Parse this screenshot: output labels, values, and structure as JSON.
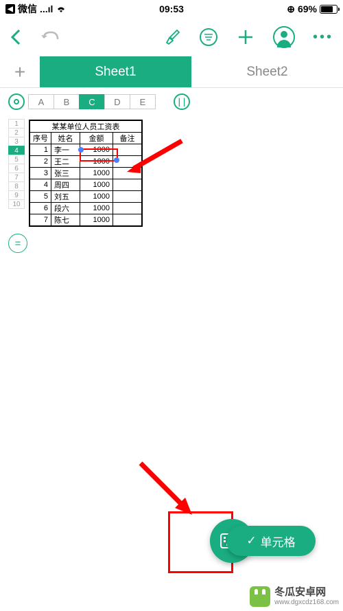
{
  "status": {
    "app": "微信",
    "signal": "...ıl",
    "wifi": "wifi-icon",
    "time": "09:53",
    "lock": "⊕",
    "battery_pct": "69%"
  },
  "toolbar": {
    "back": "back-icon",
    "undo": "undo-icon",
    "format": "brush-icon",
    "filter": "filter-icon",
    "add": "add-icon",
    "profile": "profile-icon",
    "more": "more-icon"
  },
  "sheets": {
    "add": "+",
    "tabs": [
      {
        "label": "Sheet1",
        "active": true
      },
      {
        "label": "Sheet2",
        "active": false
      }
    ]
  },
  "cols": {
    "circle_left": "○",
    "headers": [
      "A",
      "B",
      "C",
      "D",
      "E"
    ],
    "selected": "C",
    "pause": "||"
  },
  "rows": {
    "nums": [
      "1",
      "2",
      "3",
      "4",
      "5",
      "6",
      "7",
      "8",
      "9",
      "10"
    ],
    "selected": 4
  },
  "table": {
    "title": "某某单位人员工资表",
    "headers": [
      "序号",
      "姓名",
      "金额",
      "备注"
    ],
    "data": [
      [
        "1",
        "李一",
        "1000",
        ""
      ],
      [
        "2",
        "王二",
        "1000",
        ""
      ],
      [
        "3",
        "张三",
        "1000",
        ""
      ],
      [
        "4",
        "周四",
        "1000",
        ""
      ],
      [
        "5",
        "刘五",
        "1000",
        ""
      ],
      [
        "6",
        "段六",
        "1000",
        ""
      ],
      [
        "7",
        "陈七",
        "1000",
        ""
      ]
    ]
  },
  "formula_btn": "=",
  "bottom": {
    "keyboard": "keyboard-icon",
    "cell_btn": "单元格"
  },
  "watermark": {
    "title": "冬瓜安卓网",
    "url": "www.dgxcdz168.com"
  }
}
